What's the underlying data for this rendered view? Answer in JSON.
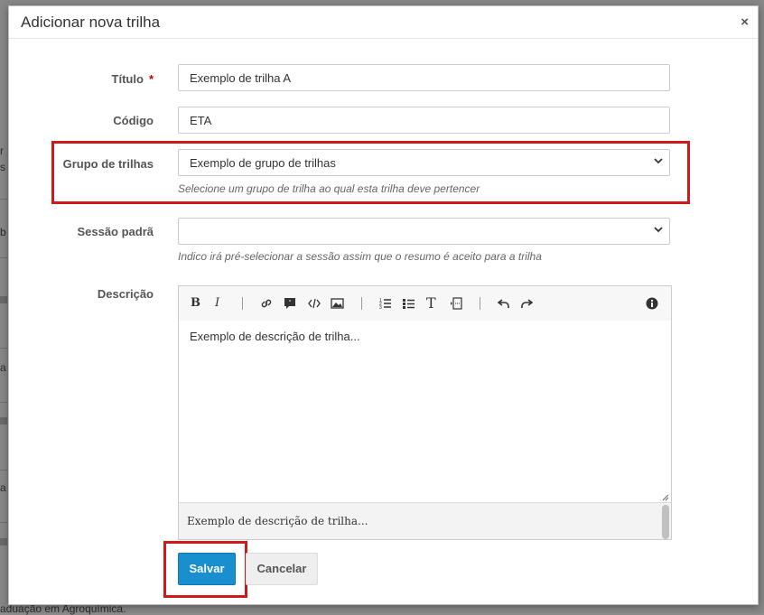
{
  "background": {
    "fragments": [
      "r",
      "s",
      "b",
      "a",
      "a"
    ],
    "footer_text": "aduação em Agroquímica."
  },
  "modal": {
    "title": "Adicionar nova trilha",
    "close_label": "×"
  },
  "form": {
    "titulo": {
      "label": "Título",
      "required_mark": "*",
      "value": "Exemplo de trilha A"
    },
    "codigo": {
      "label": "Código",
      "value": "ETA"
    },
    "grupo": {
      "label": "Grupo de trilhas",
      "selected": "Exemplo de grupo de trilhas",
      "help": "Selecione um grupo de trilha ao qual esta trilha deve pertencer"
    },
    "sessao": {
      "label": "Sessão padrã",
      "selected": "",
      "help": "Indico irá pré-selecionar a sessão assim que o resumo é aceito para a trilha"
    },
    "descricao": {
      "label": "Descrição",
      "body_text": "Exemplo de descrição de trilha...",
      "preview_text": "Exemplo de descrição de trilha..."
    }
  },
  "toolbar": {
    "bold": "B",
    "italic": "I",
    "text": "T"
  },
  "buttons": {
    "save": "Salvar",
    "cancel": "Cancelar"
  },
  "colors": {
    "highlight": "#d01a1a",
    "primary": "#1a8fd0"
  }
}
